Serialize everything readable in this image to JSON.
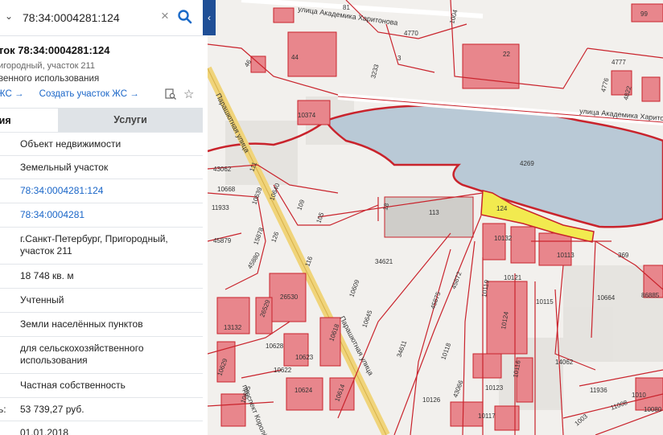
{
  "search": {
    "value": "78:34:0004281:124"
  },
  "info": {
    "title": "ток 78:34:0004281:124",
    "subtitle": "игородный, участок 211",
    "usage": "венного использования",
    "link1": "ЖС →",
    "link2": "Создать участок ЖС →"
  },
  "tabs": {
    "active": "ция",
    "services": "Услуги"
  },
  "rows": [
    {
      "label": "",
      "value": "Объект недвижимости",
      "link": false
    },
    {
      "label": "",
      "value": "Земельный участок",
      "link": false
    },
    {
      "label": "",
      "value": "78:34:0004281:124",
      "link": true
    },
    {
      "label": "",
      "value": "78:34:0004281",
      "link": true
    },
    {
      "label": "",
      "value": "г.Санкт-Петербург, Пригородный, участок 211",
      "link": false
    },
    {
      "label": "",
      "value": "18 748 кв. м",
      "link": false
    },
    {
      "label": "",
      "value": "Учтенный",
      "link": false
    },
    {
      "label": "",
      "value": "Земли населённых пунктов",
      "link": false
    },
    {
      "label": "",
      "value": "для сельскохозяйственного использования",
      "link": false
    },
    {
      "label": "",
      "value": "Частная собственность",
      "link": false
    },
    {
      "label": "ь:",
      "value": "53 739,27 руб.",
      "link": false
    },
    {
      "label": "",
      "value": "01.01.2018",
      "link": false
    }
  ],
  "map": {
    "streets": [
      "улица Академика Харитонова",
      "улица Академика Харитонова",
      "Парашютная улица",
      "Парашютная улица",
      "проспект Королёва"
    ],
    "parcels": [
      "81",
      "1004",
      "99",
      "44",
      "4770",
      "22",
      "4777",
      "46",
      "3",
      "3233",
      "4776",
      "4822",
      "10374",
      "4269",
      "43062",
      "111",
      "10668",
      "10640",
      "10639",
      "11933",
      "109",
      "105",
      "18",
      "113",
      "124",
      "10132",
      "10113",
      "369",
      "45879",
      "15878",
      "126",
      "45880",
      "116",
      "34621",
      "10121",
      "10115",
      "10664",
      "86885",
      "26530",
      "10609",
      "10119",
      "10124",
      "10116",
      "45875",
      "45872",
      "13132",
      "26529",
      "10628",
      "10618",
      "10645",
      "34611",
      "10118",
      "14062",
      "10622",
      "10623",
      "10614",
      "10126",
      "43066",
      "10123",
      "10624",
      "10629",
      "10635",
      "10117",
      "11936",
      "1010",
      "10080",
      "1003",
      "11008"
    ]
  },
  "colors": {
    "accent": "#1a66c8",
    "search_button": "#1a6ac8",
    "collapse_tab": "#1f4f96",
    "parcel_border": "#c9232c",
    "building_fill": "#e8868c",
    "selected_parcel": "#f2ea4f",
    "lake": "#b9c9d6",
    "road_highlight": "#f0d47a"
  }
}
